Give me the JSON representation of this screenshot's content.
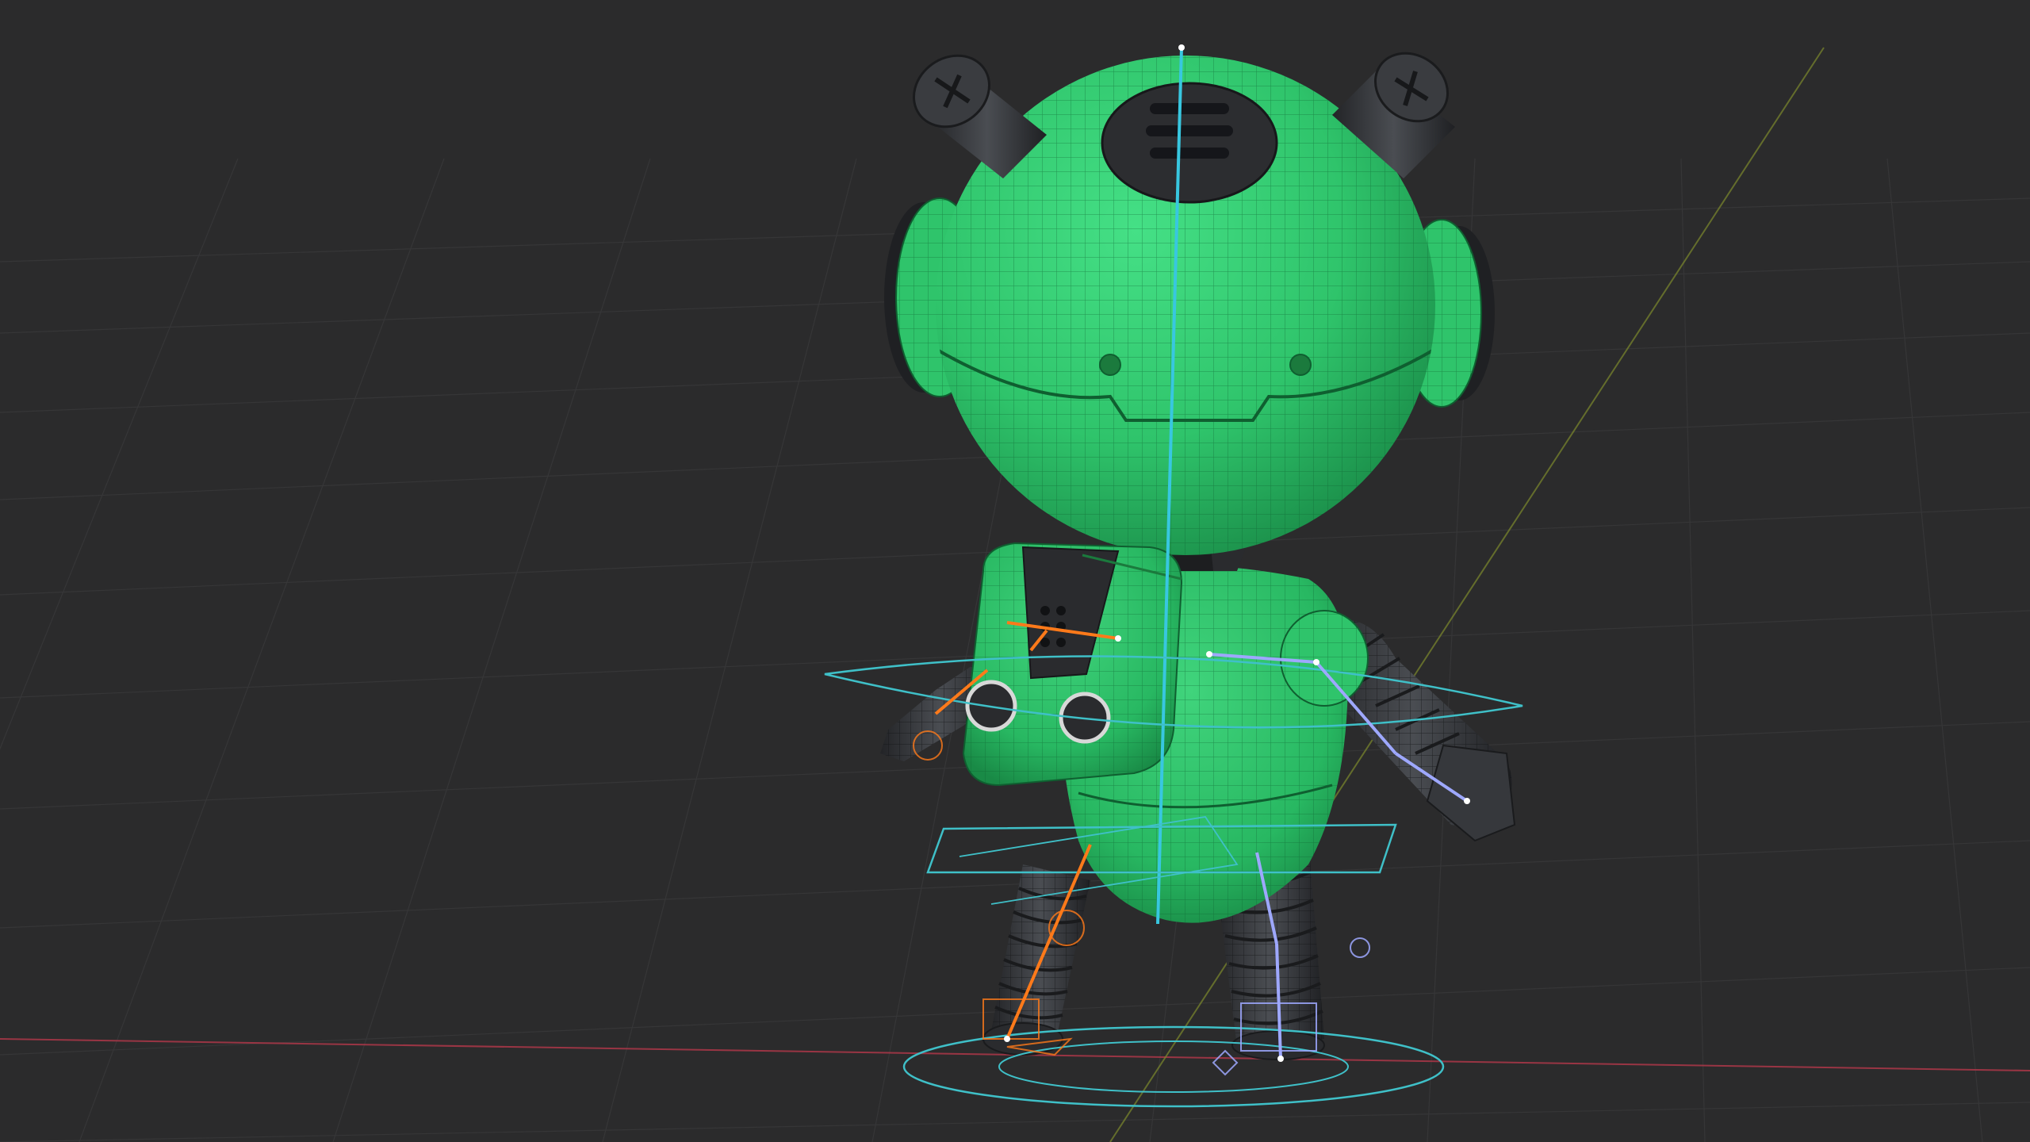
{
  "viewport": {
    "background": "#2b2b2c",
    "grid_color": "#3a3a3b",
    "x_axis_color": "#b5384a",
    "y_axis_color": "#7d8a2c"
  },
  "character": {
    "body_color": "#2fc46b",
    "body_dark": "#1e9a50",
    "wire_color": "#0f5f30",
    "metal_color": "#303236",
    "metal_light": "#4a4d52"
  },
  "rig": {
    "left_bone_color": "#ff7a1a",
    "right_bone_color": "#9ea8ff",
    "control_color": "#3fc0c8",
    "spine_color": "#38c7e0"
  }
}
